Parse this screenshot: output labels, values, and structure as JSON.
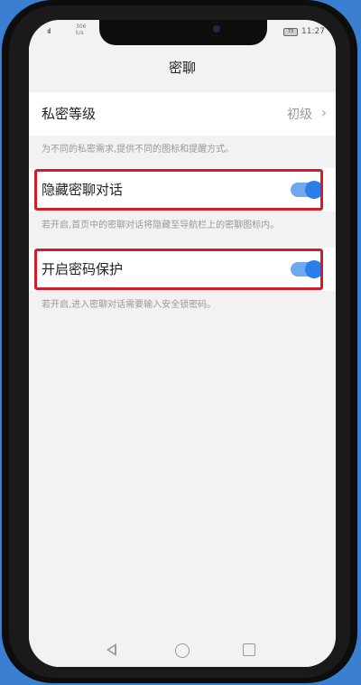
{
  "status_bar": {
    "signal": "ııl",
    "network": "306\nk/s",
    "battery": "73",
    "time": "11:27"
  },
  "header": {
    "title": "密聊"
  },
  "settings": {
    "privacy_level": {
      "label": "私密等级",
      "value": "初级",
      "description": "为不同的私密需求,提供不同的图标和提醒方式。"
    },
    "hide_chat": {
      "label": "隐藏密聊对话",
      "enabled": true,
      "description": "若开启,首页中的密聊对话将隐藏至导航栏上的密聊图标内。"
    },
    "password_protect": {
      "label": "开启密码保护",
      "enabled": true,
      "description": "若开启,进入密聊对话需要输入安全锁密码。"
    }
  },
  "nav": {
    "back": "back-icon",
    "home": "home-icon",
    "recent": "recent-apps-icon"
  },
  "colors": {
    "toggle_on": "#2b7de9",
    "highlight": "#d01f2a",
    "background": "#3b7fd1"
  }
}
